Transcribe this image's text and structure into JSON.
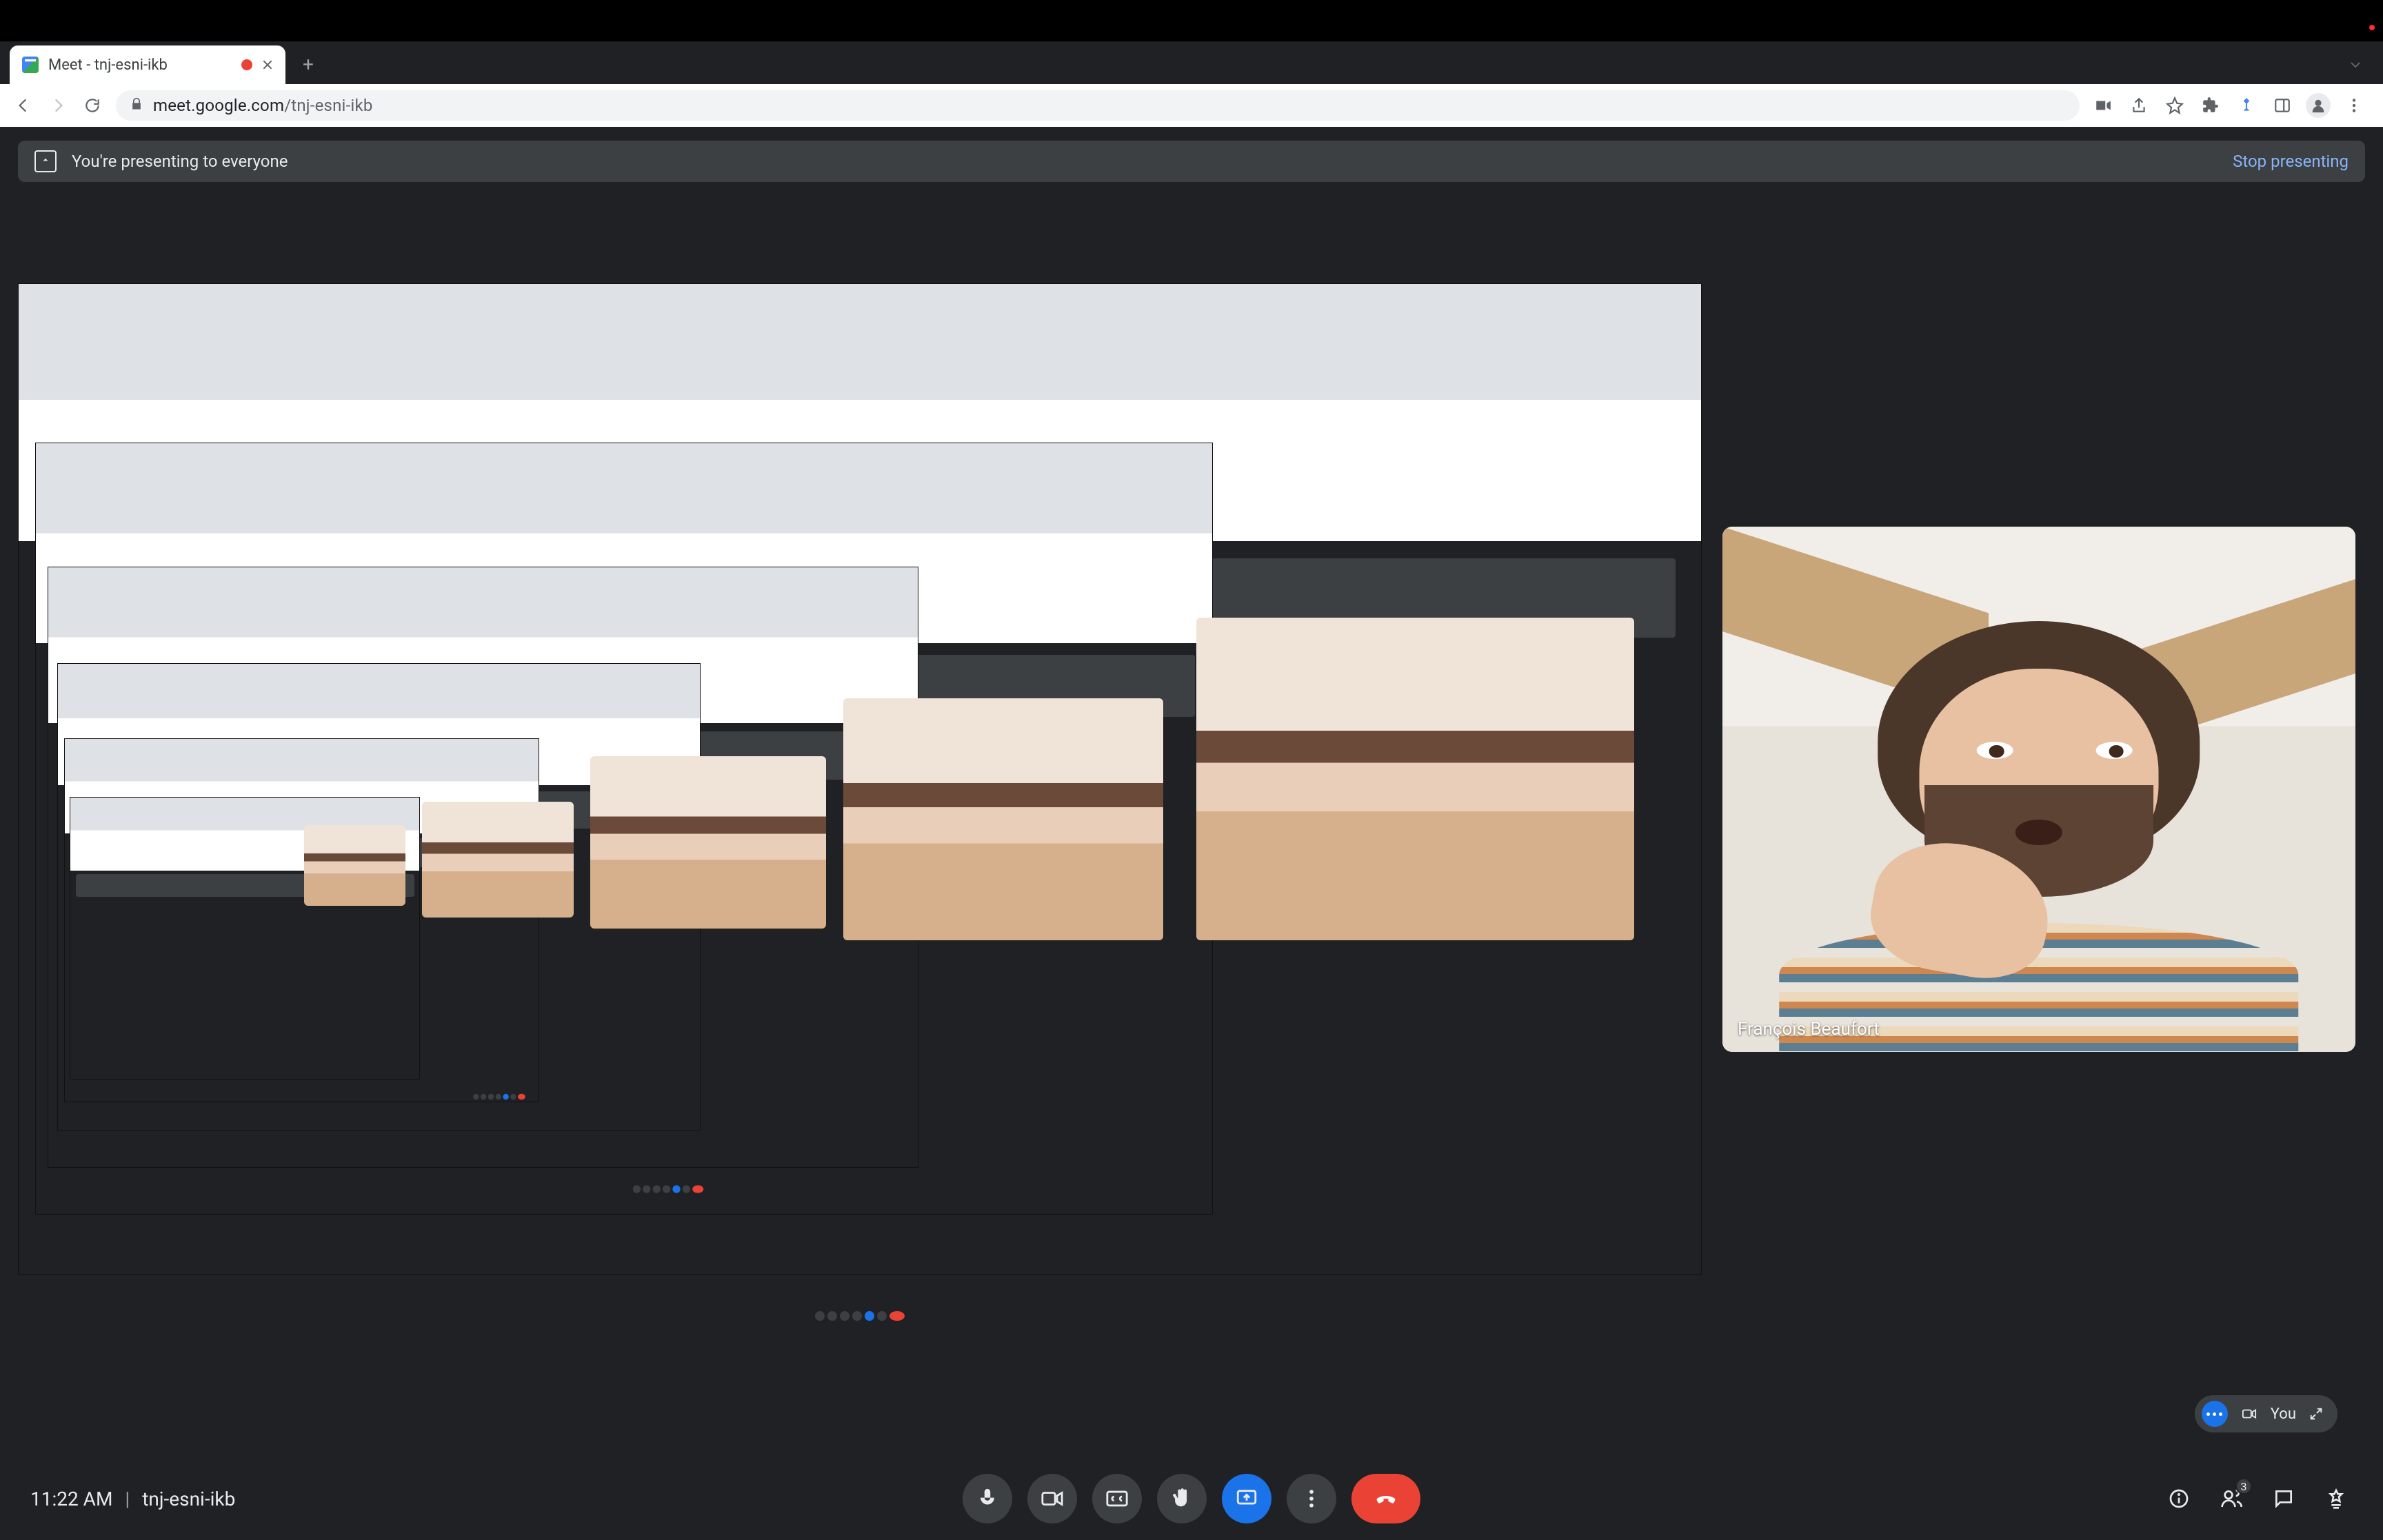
{
  "browser": {
    "tab_title": "Meet - tnj-esni-ikb",
    "url_host": "meet.google.com",
    "url_path": "/tnj-esni-ikb"
  },
  "banner": {
    "text": "You're presenting to everyone",
    "stop_label": "Stop presenting"
  },
  "participant": {
    "name": "François Beaufort"
  },
  "self_tile": {
    "label": "You"
  },
  "bottombar": {
    "time": "11:22 AM",
    "meeting_code": "tnj-esni-ikb",
    "participant_count": "3"
  },
  "icons": {
    "mic": "microphone",
    "cam": "camera",
    "cc": "closed-captions",
    "hand": "raise-hand",
    "present": "present-screen",
    "more": "more-options",
    "leave": "leave-call",
    "info": "meeting-details",
    "people": "participants",
    "chat": "chat",
    "activities": "activities"
  }
}
